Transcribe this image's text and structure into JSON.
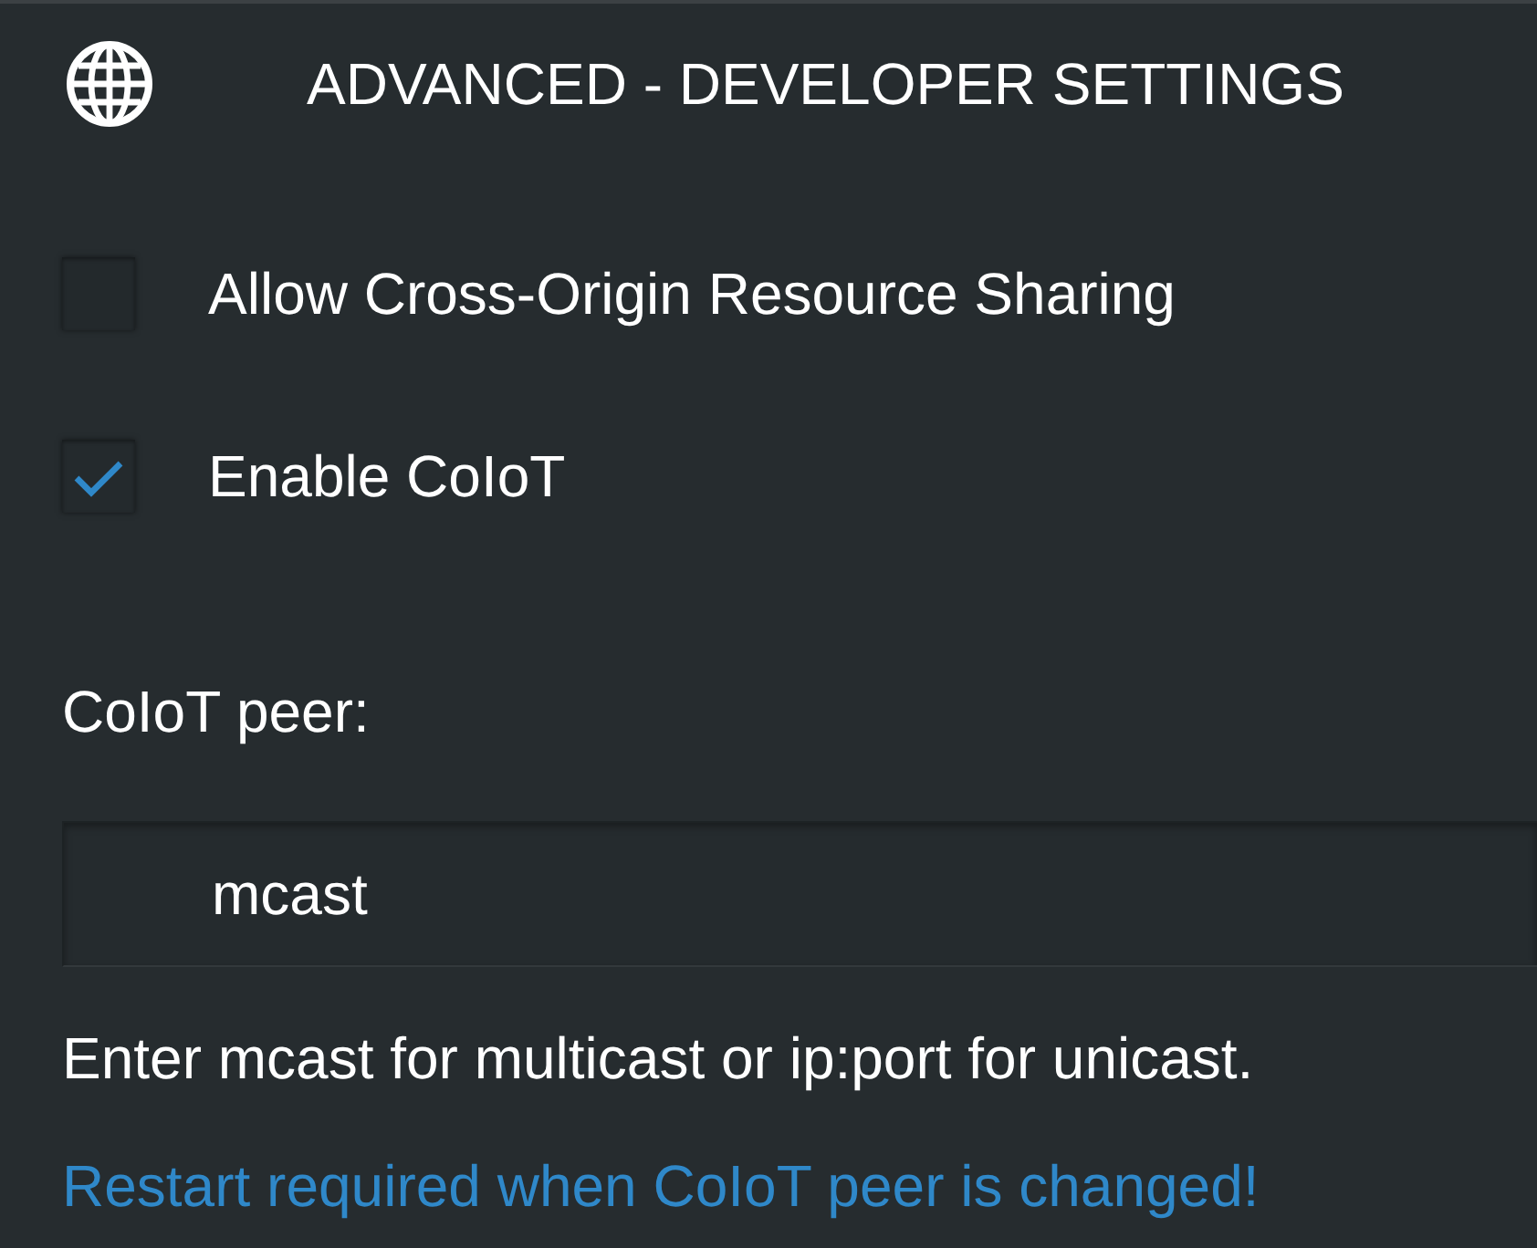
{
  "header": {
    "title": "ADVANCED - DEVELOPER SETTINGS"
  },
  "options": [
    {
      "label": "Allow Cross-Origin Resource Sharing",
      "checked": false
    },
    {
      "label": "Enable CoIoT",
      "checked": true
    }
  ],
  "peer": {
    "label": "CoIoT peer:",
    "value": "mcast",
    "hint": "Enter mcast for multicast or ip:port for unicast.",
    "warning": "Restart required when CoIoT peer is changed!"
  }
}
